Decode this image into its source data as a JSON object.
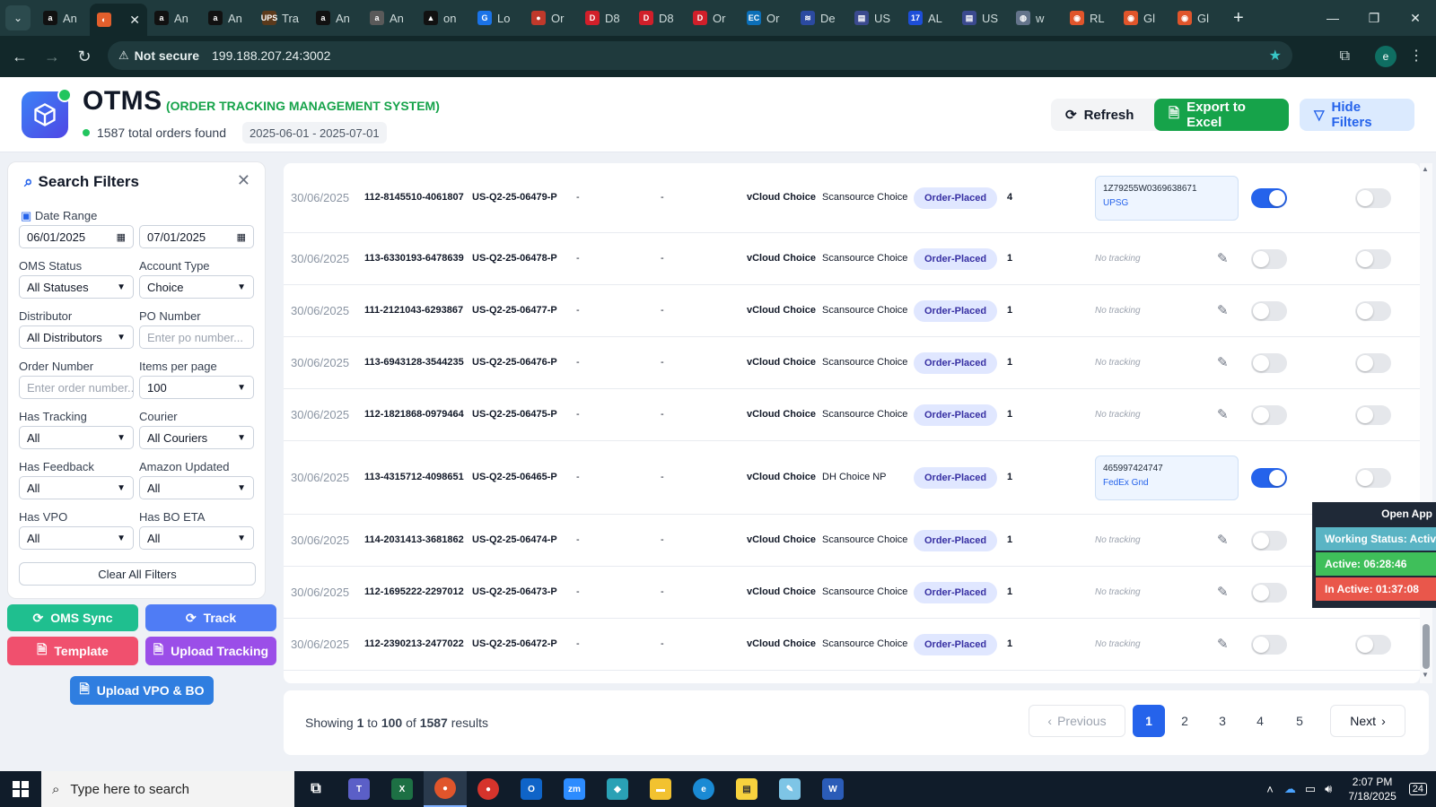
{
  "browser": {
    "tabs": [
      {
        "label": "An",
        "fav": "a",
        "color": "#111111"
      },
      {
        "label": "",
        "fav": "app-icon",
        "color": "#e25f2c",
        "active": true
      },
      {
        "label": "An",
        "fav": "a",
        "color": "#111111"
      },
      {
        "label": "An",
        "fav": "a",
        "color": "#111111"
      },
      {
        "label": "Tra",
        "fav": "UPS",
        "color": "#5b3a1c"
      },
      {
        "label": "An",
        "fav": "a",
        "color": "#111111"
      },
      {
        "label": "An",
        "fav": "a",
        "color": "#5a5a5a"
      },
      {
        "label": "on",
        "fav": "▲",
        "color": "#111111"
      },
      {
        "label": "Lo",
        "fav": "G",
        "color": "#1a73e8"
      },
      {
        "label": "Or",
        "fav": "●",
        "color": "#c0392b"
      },
      {
        "label": "D8",
        "fav": "D",
        "color": "#d11f2a"
      },
      {
        "label": "D8",
        "fav": "D",
        "color": "#d11f2a"
      },
      {
        "label": "Or",
        "fav": "D",
        "color": "#d11f2a"
      },
      {
        "label": "Or",
        "fav": "EC",
        "color": "#0b6fb8"
      },
      {
        "label": "De",
        "fav": "≋",
        "color": "#2b4aa0"
      },
      {
        "label": "US",
        "fav": "▤",
        "color": "#3b4a8f"
      },
      {
        "label": "AL",
        "fav": "17",
        "color": "#1d4ed8"
      },
      {
        "label": "US",
        "fav": "▤",
        "color": "#3b4a8f"
      },
      {
        "label": "w",
        "fav": "◍",
        "color": "#64748b"
      },
      {
        "label": "RL",
        "fav": "◉",
        "color": "#e0552b"
      },
      {
        "label": "Gl",
        "fav": "◉",
        "color": "#e0552b"
      },
      {
        "label": "Gl",
        "fav": "◉",
        "color": "#e0552b"
      }
    ],
    "not_secure": "Not secure",
    "url": "199.188.207.24:3002",
    "profile_initial": "e"
  },
  "header": {
    "brand": "OTMS",
    "brand_sub": "(ORDER TRACKING MANAGEMENT SYSTEM)",
    "total": "1587 total orders found",
    "range": "2025-06-01 - 2025-07-01",
    "refresh": "Refresh",
    "export": "Export to Excel",
    "hide": "Hide Filters"
  },
  "filters": {
    "title": "Search Filters",
    "date_range_label": "Date Range",
    "date_from": "06/01/2025",
    "date_to": "07/01/2025",
    "oms_status_label": "OMS Status",
    "oms_status": "All Statuses",
    "account_type_label": "Account Type",
    "account_type": "Choice",
    "distributor_label": "Distributor",
    "distributor": "All Distributors",
    "po_label": "PO Number",
    "po_placeholder": "Enter po number...",
    "order_label": "Order Number",
    "order_placeholder": "Enter order number...",
    "ipp_label": "Items per page",
    "ipp": "100",
    "has_tracking_label": "Has Tracking",
    "has_tracking": "All",
    "courier_label": "Courier",
    "courier": "All Couriers",
    "has_feedback_label": "Has Feedback",
    "has_feedback": "All",
    "amazon_updated_label": "Amazon Updated",
    "amazon_updated": "All",
    "has_vpo_label": "Has VPO",
    "has_vpo": "All",
    "has_bo_label": "Has BO ETA",
    "has_bo": "All",
    "clear": "Clear All Filters"
  },
  "actions": {
    "oms_sync": "OMS Sync",
    "track": "Track",
    "template": "Template",
    "upload_tracking": "Upload Tracking",
    "upload_vpo": "Upload VPO & BO"
  },
  "rows": [
    {
      "date": "30/06/2025",
      "order": "112-8145510-4061807",
      "po": "US-Q2-25-06479-P",
      "c1": "-",
      "c2": "-",
      "account": "vCloud Choice",
      "dist": "Scansource Choice",
      "status": "Order-Placed",
      "qty": "4",
      "tracking": "1Z79255W0369638671",
      "carrier": "UPSG",
      "t1": true,
      "t2": false
    },
    {
      "date": "30/06/2025",
      "order": "113-6330193-6478639",
      "po": "US-Q2-25-06478-P",
      "c1": "-",
      "c2": "-",
      "account": "vCloud Choice",
      "dist": "Scansource Choice",
      "status": "Order-Placed",
      "qty": "1",
      "tracking": "",
      "carrier": "",
      "t1": false,
      "t2": false
    },
    {
      "date": "30/06/2025",
      "order": "111-2121043-6293867",
      "po": "US-Q2-25-06477-P",
      "c1": "-",
      "c2": "-",
      "account": "vCloud Choice",
      "dist": "Scansource Choice",
      "status": "Order-Placed",
      "qty": "1",
      "tracking": "",
      "carrier": "",
      "t1": false,
      "t2": false
    },
    {
      "date": "30/06/2025",
      "order": "113-6943128-3544235",
      "po": "US-Q2-25-06476-P",
      "c1": "-",
      "c2": "-",
      "account": "vCloud Choice",
      "dist": "Scansource Choice",
      "status": "Order-Placed",
      "qty": "1",
      "tracking": "",
      "carrier": "",
      "t1": false,
      "t2": false
    },
    {
      "date": "30/06/2025",
      "order": "112-1821868-0979464",
      "po": "US-Q2-25-06475-P",
      "c1": "-",
      "c2": "-",
      "account": "vCloud Choice",
      "dist": "Scansource Choice",
      "status": "Order-Placed",
      "qty": "1",
      "tracking": "",
      "carrier": "",
      "t1": false,
      "t2": false
    },
    {
      "date": "30/06/2025",
      "order": "113-4315712-4098651",
      "po": "US-Q2-25-06465-P",
      "c1": "-",
      "c2": "-",
      "account": "vCloud Choice",
      "dist": "DH Choice NP",
      "status": "Order-Placed",
      "qty": "1",
      "tracking": "465997424747",
      "carrier": "FedEx Gnd",
      "t1": true,
      "t2": false
    },
    {
      "date": "30/06/2025",
      "order": "114-2031413-3681862",
      "po": "US-Q2-25-06474-P",
      "c1": "-",
      "c2": "-",
      "account": "vCloud Choice",
      "dist": "Scansource Choice",
      "status": "Order-Placed",
      "qty": "1",
      "tracking": "",
      "carrier": "",
      "t1": false,
      "t2": false
    },
    {
      "date": "30/06/2025",
      "order": "112-1695222-2297012",
      "po": "US-Q2-25-06473-P",
      "c1": "-",
      "c2": "-",
      "account": "vCloud Choice",
      "dist": "Scansource Choice",
      "status": "Order-Placed",
      "qty": "1",
      "tracking": "",
      "carrier": "",
      "t1": false,
      "t2": false
    },
    {
      "date": "30/06/2025",
      "order": "112-2390213-2477022",
      "po": "US-Q2-25-06472-P",
      "c1": "-",
      "c2": "-",
      "account": "vCloud Choice",
      "dist": "Scansource Choice",
      "status": "Order-Placed",
      "qty": "1",
      "tracking": "",
      "carrier": "",
      "t1": false,
      "t2": false
    }
  ],
  "no_tracking": "No tracking",
  "pager": {
    "showing": "Showing",
    "from": "1",
    "to_word": "to",
    "to": "100",
    "of_word": "of",
    "total": "1587",
    "results": "results",
    "prev": "Previous",
    "next": "Next",
    "pages": [
      "1",
      "2",
      "3",
      "4",
      "5"
    ]
  },
  "widget": {
    "open": "Open App",
    "working": "Working Status: Active",
    "active": "Active: 06:28:46",
    "inactive": "In Active: 01:37:08"
  },
  "taskbar": {
    "search": "Type here to search",
    "time": "2:07 PM",
    "date": "7/18/2025",
    "notif": "24"
  }
}
